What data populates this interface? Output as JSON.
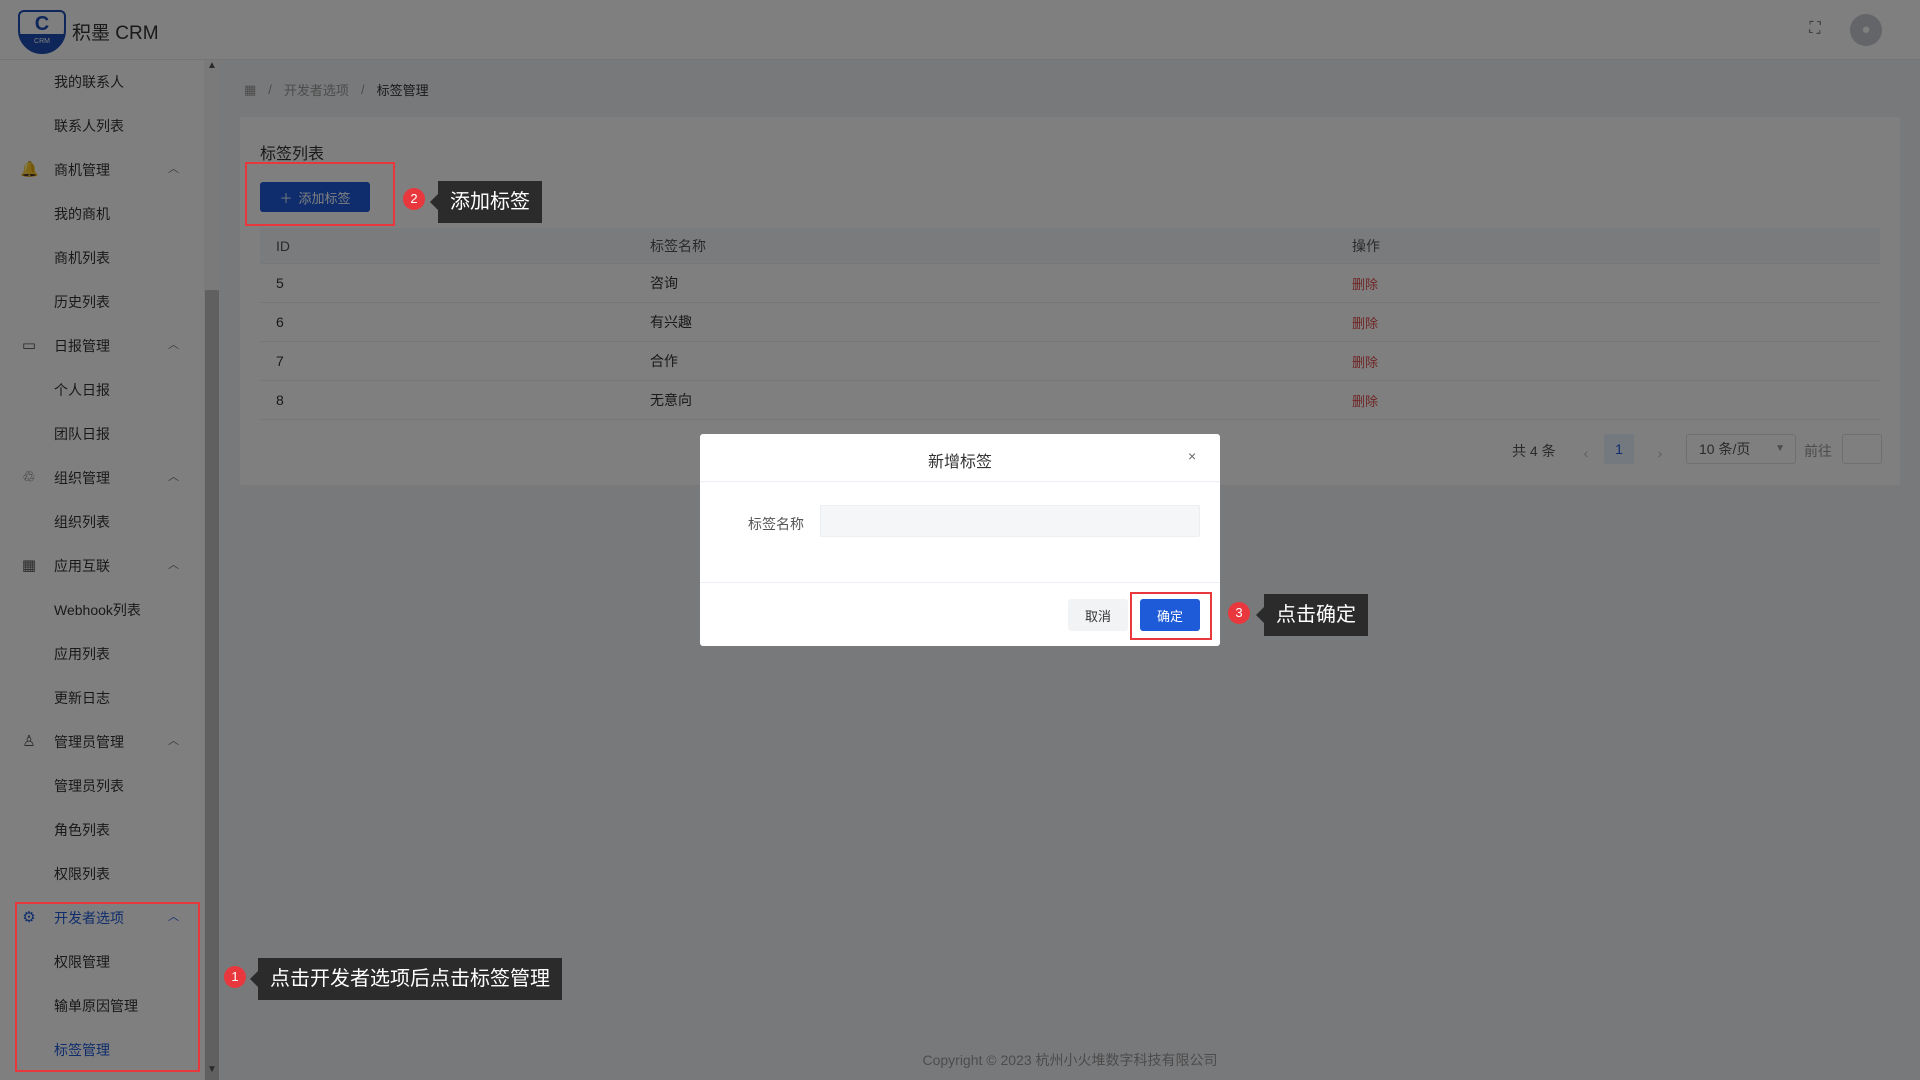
{
  "header": {
    "logo_text": "CRM",
    "logo_mark": "C",
    "app_title": "积墨 CRM",
    "fullscreen_icon": "fullscreen-icon",
    "avatar_icon": "user-icon"
  },
  "sidebar": {
    "items": [
      {
        "label": "我的联系人",
        "type": "sub"
      },
      {
        "label": "联系人列表",
        "type": "sub"
      },
      {
        "label": "商机管理",
        "type": "group",
        "icon": "bell-icon"
      },
      {
        "label": "我的商机",
        "type": "sub"
      },
      {
        "label": "商机列表",
        "type": "sub"
      },
      {
        "label": "历史列表",
        "type": "sub"
      },
      {
        "label": "日报管理",
        "type": "group",
        "icon": "calendar-icon"
      },
      {
        "label": "个人日报",
        "type": "sub"
      },
      {
        "label": "团队日报",
        "type": "sub"
      },
      {
        "label": "组织管理",
        "type": "group",
        "icon": "org-icon"
      },
      {
        "label": "组织列表",
        "type": "sub"
      },
      {
        "label": "应用互联",
        "type": "group",
        "icon": "grid-icon"
      },
      {
        "label": "Webhook列表",
        "type": "sub"
      },
      {
        "label": "应用列表",
        "type": "sub"
      },
      {
        "label": "更新日志",
        "type": "sub"
      },
      {
        "label": "管理员管理",
        "type": "group",
        "icon": "user-icon"
      },
      {
        "label": "管理员列表",
        "type": "sub"
      },
      {
        "label": "角色列表",
        "type": "sub"
      },
      {
        "label": "权限列表",
        "type": "sub"
      },
      {
        "label": "开发者选项",
        "type": "group",
        "icon": "gear-icon",
        "active": true
      },
      {
        "label": "权限管理",
        "type": "sub"
      },
      {
        "label": "输单原因管理",
        "type": "sub"
      },
      {
        "label": "标签管理",
        "type": "sub",
        "active": true
      }
    ]
  },
  "breadcrumb": {
    "home_icon": "grid-icon",
    "separator": "/",
    "items": [
      "开发者选项",
      "标签管理"
    ]
  },
  "panel": {
    "title": "标签列表",
    "add_button": "添加标签"
  },
  "table": {
    "columns": [
      "ID",
      "标签名称",
      "操作"
    ],
    "rows": [
      {
        "id": "5",
        "name": "咨询",
        "action": "删除"
      },
      {
        "id": "6",
        "name": "有兴趣",
        "action": "删除"
      },
      {
        "id": "7",
        "name": "合作",
        "action": "删除"
      },
      {
        "id": "8",
        "name": "无意向",
        "action": "删除"
      }
    ]
  },
  "pagination": {
    "total": "共 4 条",
    "current_page": "1",
    "page_size": "10 条/页",
    "goto_label": "前往"
  },
  "footer": {
    "copyright": "Copyright © 2023 杭州小火堆数字科技有限公司"
  },
  "dialog": {
    "title": "新增标签",
    "close": "×",
    "field_label": "标签名称",
    "field_value": "",
    "cancel": "取消",
    "confirm": "确定"
  },
  "annotations": [
    {
      "number": "1",
      "text": "点击开发者选项后点击标签管理"
    },
    {
      "number": "2",
      "text": "添加标签"
    },
    {
      "number": "3",
      "text": "点击确定"
    }
  ],
  "colors": {
    "primary": "#1e5bd8",
    "danger": "#e14b4b",
    "highlight": "#e8383d"
  }
}
